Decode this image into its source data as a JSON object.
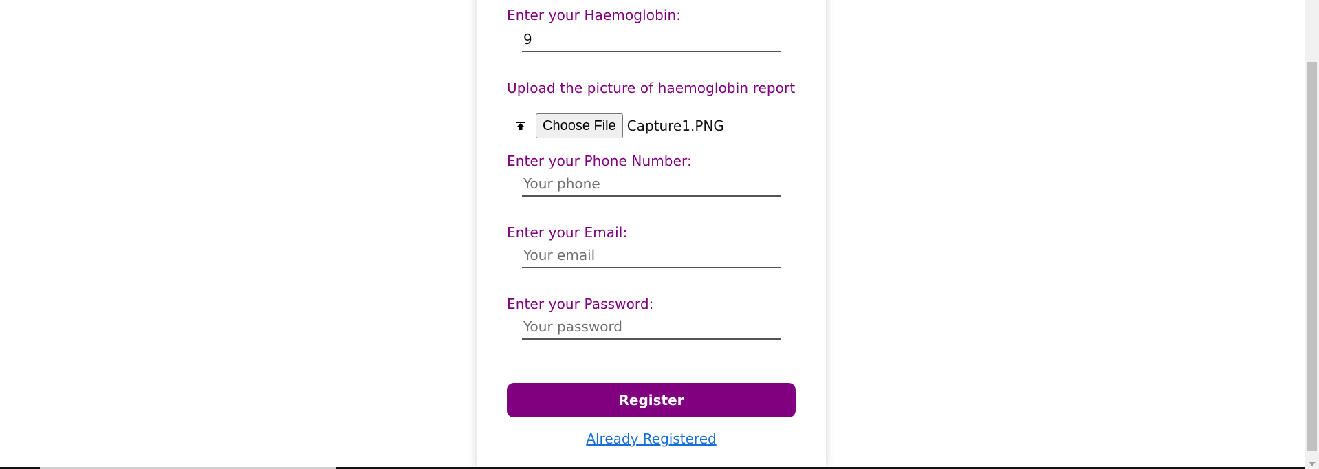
{
  "form": {
    "haemoglobin_label": "Enter your Haemoglobin:",
    "haemoglobin_value": "9",
    "upload_label": "Upload the picture of haemoglobin report",
    "upload_button_label": "Choose File",
    "upload_file_name": "Capture1.PNG",
    "upload_icon": "upload-icon",
    "phone_label": "Enter your Phone Number:",
    "phone_placeholder": "Your phone",
    "email_label": "Enter your Email:",
    "email_placeholder": "Your email",
    "password_label": "Enter your Password:",
    "password_placeholder": "Your password",
    "register_label": "Register",
    "login_link": "Already Registered"
  },
  "colors": {
    "accent": "#800080",
    "link": "#1a6fd6"
  }
}
